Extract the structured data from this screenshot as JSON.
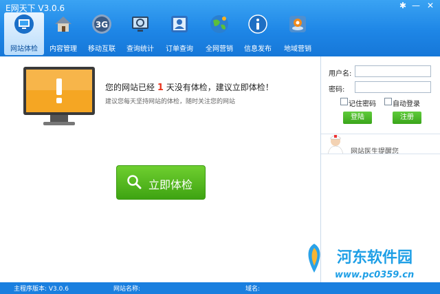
{
  "app": {
    "title": "E网天下 V3.0.6"
  },
  "toolbar": [
    {
      "label": "网站体检",
      "icon": "monitor-icon",
      "active": true
    },
    {
      "label": "内容管理",
      "icon": "house-icon"
    },
    {
      "label": "移动互联",
      "icon": "3g-icon"
    },
    {
      "label": "查询统计",
      "icon": "chart-screen-icon"
    },
    {
      "label": "订单查询",
      "icon": "contacts-icon"
    },
    {
      "label": "全网营销",
      "icon": "globe-icon"
    },
    {
      "label": "信息发布",
      "icon": "info-icon"
    },
    {
      "label": "地域营销",
      "icon": "location-icon"
    }
  ],
  "main": {
    "warning_pre": "您的网站已经",
    "warning_num": "1",
    "warning_post": "天没有体检，建议立即体检！",
    "sub": "建议您每天坚持网站的体检，随时关注您的网站",
    "check_button": "立即体检"
  },
  "login": {
    "username_label": "用户名:",
    "password_label": "密码:",
    "remember_label": "记住密码",
    "autologin_label": "自动登录",
    "login_button": "登陆",
    "register_button": "注册"
  },
  "doctor": {
    "text": "网站医生提醒您"
  },
  "status": {
    "version": "主程序版本: V3.0.6",
    "site_name": "网站名称:",
    "domain": "域名:"
  },
  "watermark": {
    "title": "河东软件园",
    "url": "www.pc0359.cn"
  },
  "colors": {
    "titlebar": "#1e86e6",
    "accent_green": "#3ea312",
    "warn_red": "#e8321b",
    "statusbar": "#1a7fdf"
  }
}
